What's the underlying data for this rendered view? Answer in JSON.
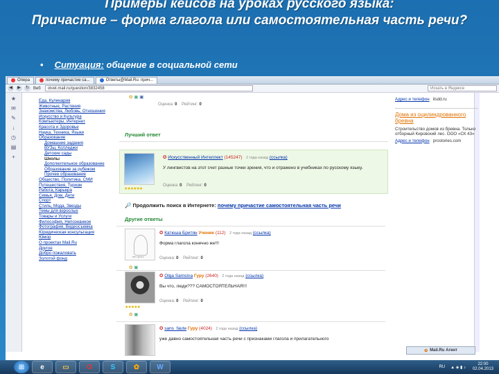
{
  "slide": {
    "title_line1": "Примеры кейсов на уроках русского языка:",
    "title_line2": "Причастие – форма глагола или самостоятельная часть речи?",
    "bullet_label": "Ситуация:",
    "bullet_text": " общение в социальной сети"
  },
  "browser": {
    "tabs": [
      "Опера",
      "почему причастие са...",
      "Ответы@Mail.Ru: прич..."
    ],
    "address_prefix": "Веб",
    "url": "otvet.mail.ru/question/3832458",
    "search_placeholder": "Искать в Яндексе"
  },
  "categories": [
    {
      "label": "Еда, Кулинария",
      "level": 0
    },
    {
      "label": "Животные, Растения",
      "level": 0
    },
    {
      "label": "Знакомства, Любовь, Отношения",
      "level": 0
    },
    {
      "label": "Искусство и Культура",
      "level": 0
    },
    {
      "label": "Компьютеры, Интернет",
      "level": 0
    },
    {
      "label": "Красота и Здоровье",
      "level": 0
    },
    {
      "label": "Наука, Техника, Языки",
      "level": 0
    },
    {
      "label": "Образование",
      "level": 0
    },
    {
      "label": "Домашние задания",
      "level": 1
    },
    {
      "label": "ВУЗы, Колледжи",
      "level": 1
    },
    {
      "label": "Детские сады",
      "level": 1
    },
    {
      "label": "Школы",
      "level": 1
    },
    {
      "label": "Дополнительное образование",
      "level": 1
    },
    {
      "label": "Образование за рубежом",
      "level": 1
    },
    {
      "label": "Прочее образование",
      "level": 1
    },
    {
      "label": "Общество, Политика, СМИ",
      "level": 0
    },
    {
      "label": "Путешествия, Туризм",
      "level": 0
    },
    {
      "label": "Работа, Карьера",
      "level": 0
    },
    {
      "label": "Семья, Дом, Дети",
      "level": 0
    },
    {
      "label": "Спорт",
      "level": 0
    },
    {
      "label": "Стиль, Мода, Звезды",
      "level": 0
    },
    {
      "label": "Темы для взрослых",
      "level": 0
    },
    {
      "label": "Товары и Услуги",
      "level": 0
    },
    {
      "label": "Философия, Непознанное",
      "level": 0
    },
    {
      "label": "Фотография, Видеосъемка",
      "level": 0
    },
    {
      "label": "Юридическая консультация",
      "level": 0
    },
    {
      "label": "Юмор",
      "level": 0
    },
    {
      "label": "О проектах Mail.Ru",
      "level": 0
    },
    {
      "label": "Другое",
      "level": 0
    },
    {
      "label": "Добро пожаловать",
      "level": 0
    },
    {
      "label": "Золотой фонд",
      "level": 0
    }
  ],
  "top_rating": {
    "score_label": "Оценка:",
    "score": "0",
    "rating_label": "Рейтинг:",
    "rating": "0"
  },
  "best_answer": {
    "heading": "Лучший ответ",
    "user": "Искусственный Интеллект",
    "points": "(145247)",
    "time": "2 года назад",
    "link": "(ссылка)",
    "text": "У лингвистов на этот счет разные точки зрения, что и отражено в учебниках по русскому языку.",
    "score": "0",
    "rating": "0"
  },
  "continue_search": {
    "label": "Продолжить поиск в Интернете:",
    "query": "почему причастие самостоятельная часть речи"
  },
  "other_heading": "Другие ответы",
  "answers": [
    {
      "user": "Катюша Бритян",
      "status": "Ученик",
      "points": "(112)",
      "time": "2 года назад",
      "link": "(ссылка)",
      "text": "Форма глагола конечно же!!!",
      "score": "0",
      "rating": "0",
      "avatar_caption": "нет фото"
    },
    {
      "user": "Olga Samsina",
      "status": "Гуру",
      "points": "(2640)",
      "time": "2 года назад",
      "link": "(ссылка)",
      "text": "Вы что, люди??? САМОСТОЯТЕЛЬНАЯ!!!",
      "score": "0",
      "rating": "0"
    },
    {
      "user": "sans_faute",
      "status": "Гуру",
      "points": "(4024)",
      "time": "2 года назад",
      "link": "(ссылка)",
      "text": "уже давно самостоятельная часть речи с признаками глагола и прилагательного",
      "score": "",
      "rating": ""
    }
  ],
  "ads": [
    {
      "addr": "Адрес и телефон",
      "domain": "ilsdd.ru"
    },
    {
      "title": "Дома из оцилиндрованного бревна",
      "text": "Строительство домов из бревна. Только отборный Кировский лес. ООО «СК 43»",
      "addr": "Адрес и телефон",
      "domain": "prostories.com"
    }
  ],
  "agent_label": "Mail.Ru Агент",
  "taskbar": {
    "lang": "RU",
    "time": "22:00",
    "date": "02.04.2013"
  },
  "colors": {
    "slide_bg": "#1c6fb0",
    "link": "#0033aa",
    "best_bg": "#eef8e6",
    "accent": "#e07000"
  }
}
